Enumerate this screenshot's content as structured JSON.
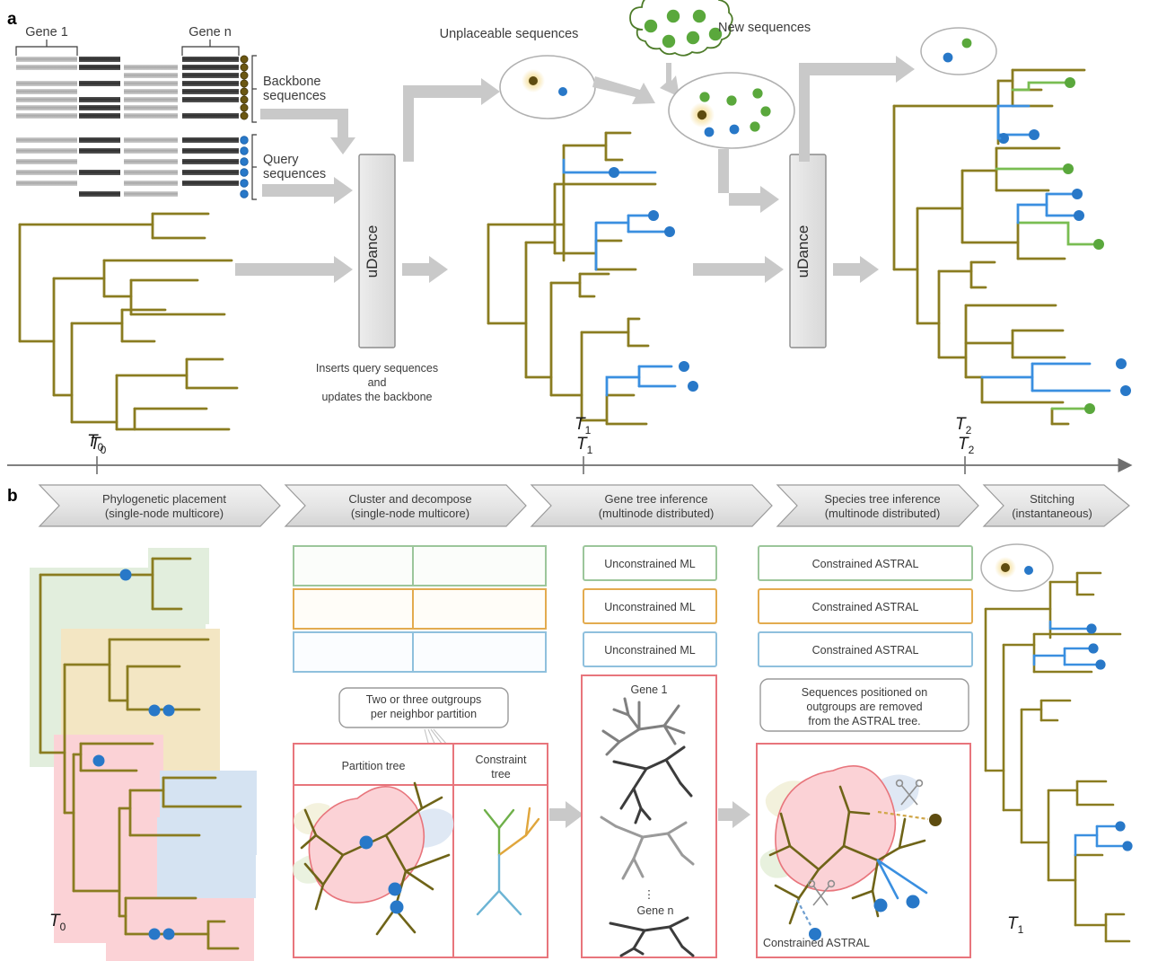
{
  "figure": {
    "panels": [
      {
        "letter": "a"
      },
      {
        "letter": "b"
      }
    ]
  },
  "panel_a": {
    "letter": "a",
    "alignment": {
      "gene_first_label": "Gene 1",
      "gene_last_label": "Gene n",
      "backbone_label_line1": "Backbone",
      "backbone_label_line2": "sequences",
      "query_label_line1": "Query",
      "query_label_line2": "sequences",
      "backbone_rows": 8,
      "query_rows": 6
    },
    "udance_box_1": {
      "label": "uDance"
    },
    "udance_box_2": {
      "label": "uDance"
    },
    "udance_caption_line1": "Inserts query sequences",
    "udance_caption_line2": "and",
    "udance_caption_line3": "updates the backbone",
    "unplaceable_label": "Unplaceable sequences",
    "new_sequences_label": "New sequences",
    "timeline": {
      "ticks": [
        {
          "label": "T",
          "sub": "0"
        },
        {
          "label": "T",
          "sub": "1"
        },
        {
          "label": "T",
          "sub": "2"
        }
      ]
    },
    "tree_labels": [
      {
        "label": "T",
        "sub": "0"
      },
      {
        "label": "T",
        "sub": "1"
      },
      {
        "label": "T",
        "sub": "2"
      }
    ]
  },
  "panel_b": {
    "letter": "b",
    "stages": [
      {
        "line1": "Phylogenetic placement",
        "line2": "(single-node multicore)"
      },
      {
        "line1": "Cluster and decompose",
        "line2": "(single-node multicore)"
      },
      {
        "line1": "Gene tree inference",
        "line2": "(multinode distributed)"
      },
      {
        "line1": "Species tree inference",
        "line2": "(multinode distributed)"
      },
      {
        "line1": "Stitching",
        "line2": "(instantaneous)"
      }
    ],
    "partition_rows": [
      {
        "color": "#9cc69b",
        "ml_label": "Unconstrained ML",
        "astral_label": "Constrained ASTRAL"
      },
      {
        "color": "#e3ab4f",
        "ml_label": "Unconstrained ML",
        "astral_label": "Constrained ASTRAL"
      },
      {
        "color": "#8fc0dd",
        "ml_label": "Unconstrained ML",
        "astral_label": "Constrained ASTRAL"
      }
    ],
    "outgroups_callout_line1": "Two or three outgroups",
    "outgroups_callout_line2": "per neighbor partition",
    "partition_tree_label": "Partition tree",
    "constraint_tree_label_line1": "Constraint",
    "constraint_tree_label_line2": "tree",
    "gene_box": {
      "first": "Gene 1",
      "last": "Gene n",
      "ellipsis": "⋮"
    },
    "astral_callout_line1": "Sequences positioned on",
    "astral_callout_line2": "outgroups are removed",
    "astral_callout_line3": "from the ASTRAL tree.",
    "constrained_astral_label": "Constrained ASTRAL",
    "left_tree_label": {
      "label": "T",
      "sub": "0"
    },
    "right_tree_label": {
      "label": "T",
      "sub": "1"
    }
  },
  "colors": {
    "branch_olive": "#8a7c20",
    "branch_olive_dark": "#6f6418",
    "blue": "#2878c8",
    "blue_light": "#3a8fe0",
    "green": "#5aa83c",
    "green_light": "#79bd52",
    "arrow_gray": "#c9c9c9",
    "box_gray": "#e6e6e6",
    "box_border": "#8c8c8c",
    "pink_border": "#e8757c",
    "pink_fill": "#f9c9ce",
    "clade_green": "#e2eedd",
    "clade_gold": "#f3e6c3",
    "clade_pink": "#fbd2d6",
    "clade_blue": "#d5e3f2",
    "dot_olive": "#5e4c10",
    "halo_yellow": "#f6e3a8",
    "matrix_light": "#b3b3b3",
    "matrix_dark": "#3b3b3b"
  }
}
